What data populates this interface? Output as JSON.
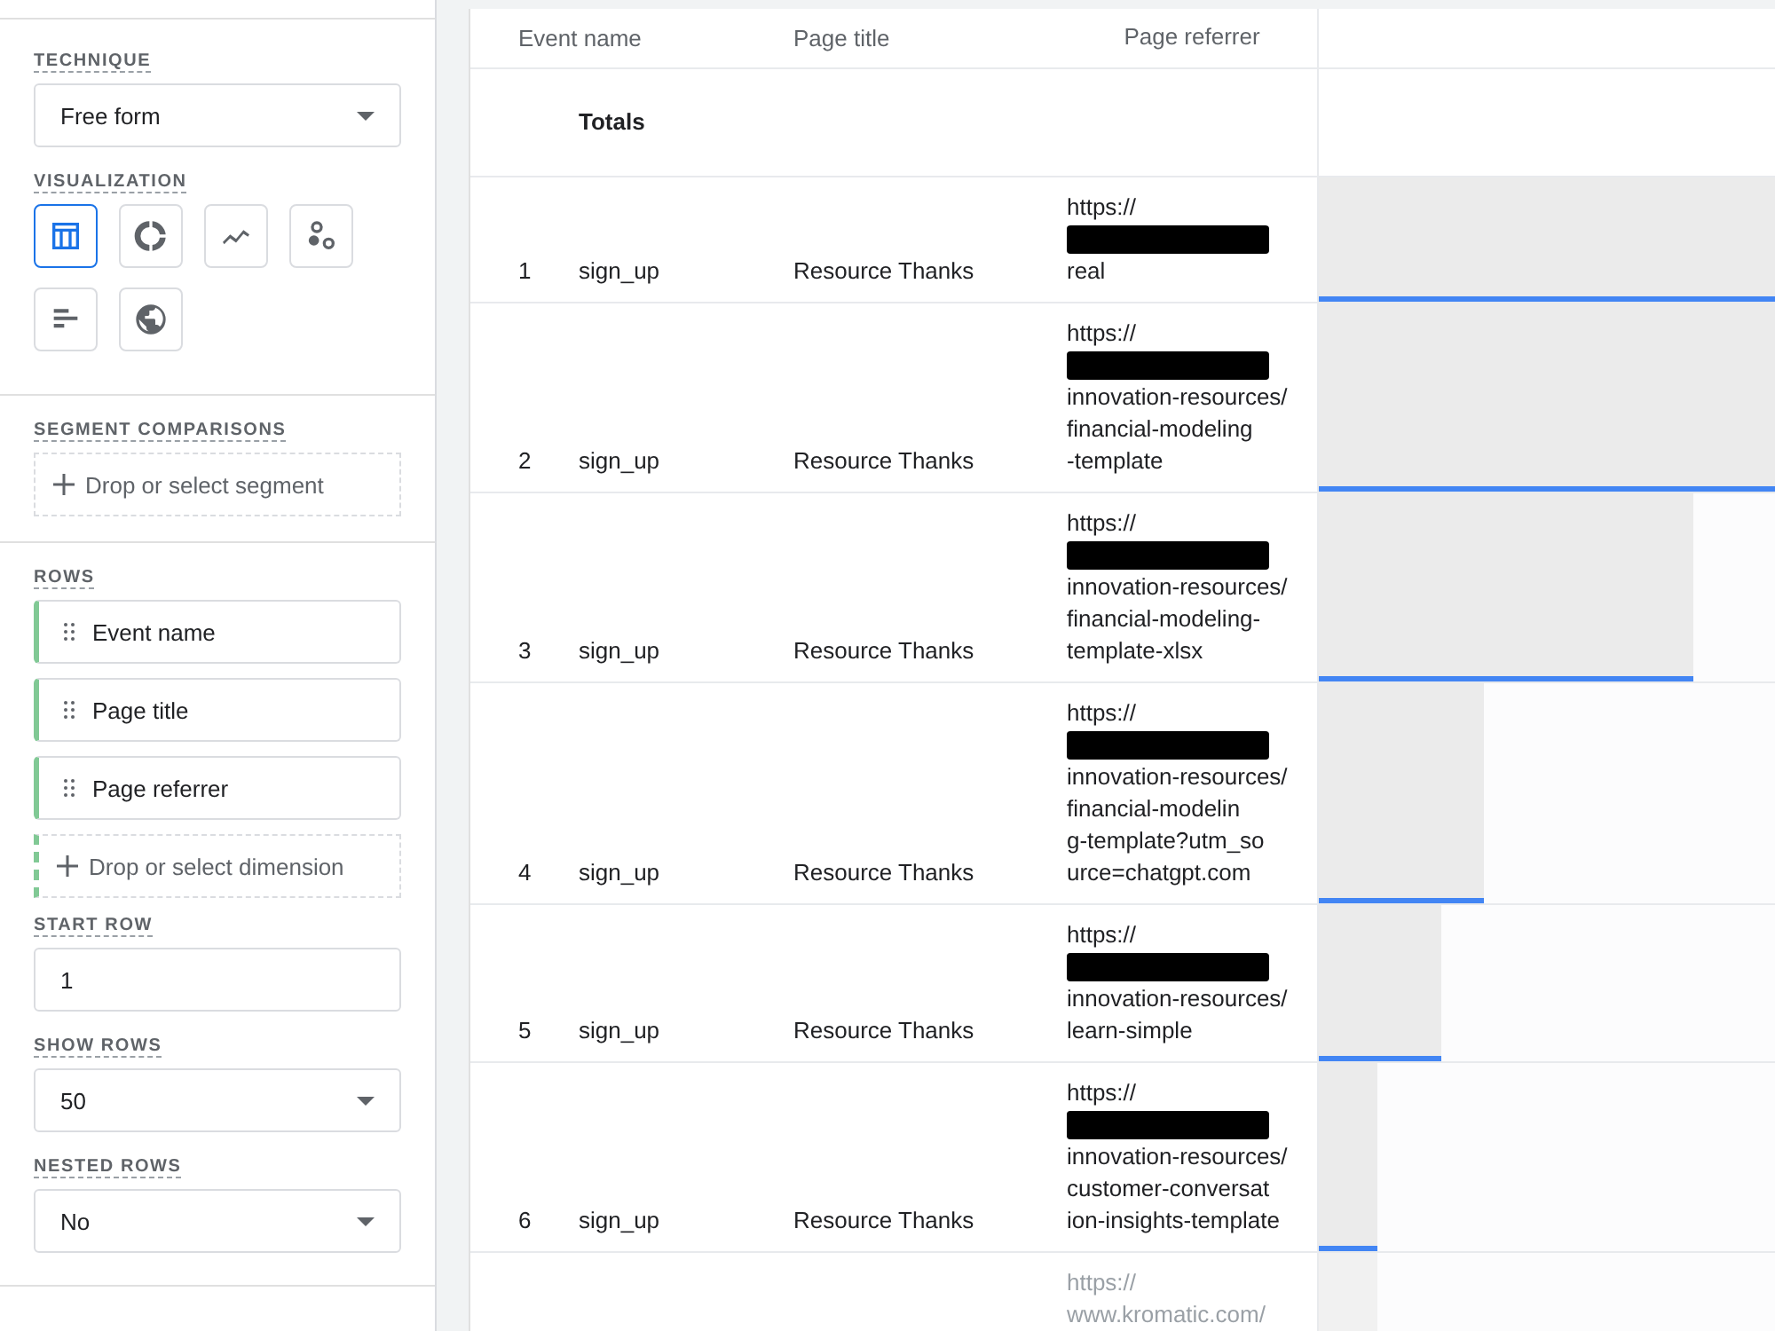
{
  "settings": {
    "technique": {
      "label": "TECHNIQUE",
      "value": "Free form"
    },
    "visualization": {
      "label": "VISUALIZATION",
      "options": [
        {
          "kind": "table",
          "selected": true
        },
        {
          "kind": "donut",
          "selected": false
        },
        {
          "kind": "line",
          "selected": false
        },
        {
          "kind": "scatter",
          "selected": false
        },
        {
          "kind": "bar",
          "selected": false
        },
        {
          "kind": "geo",
          "selected": false
        }
      ]
    },
    "segment_comparisons": {
      "label": "SEGMENT COMPARISONS",
      "drop": "Drop or select segment"
    },
    "rows": {
      "label": "ROWS",
      "items": [
        "Event name",
        "Page title",
        "Page referrer"
      ],
      "drop": "Drop or select dimension"
    },
    "start_row": {
      "label": "START ROW",
      "value": "1"
    },
    "show_rows": {
      "label": "SHOW ROWS",
      "value": "50"
    },
    "nested_rows": {
      "label": "NESTED ROWS",
      "value": "No"
    }
  },
  "table": {
    "columns": [
      "Event name",
      "Page title",
      "Page referrer"
    ],
    "totals_label": "Totals",
    "rows": [
      {
        "index": "1",
        "event": "sign_up",
        "title": "Resource Thanks",
        "referrer": [
          "https://",
          "real"
        ],
        "redacted": true,
        "level": 1.0,
        "faded": false
      },
      {
        "index": "2",
        "event": "sign_up",
        "title": "Resource Thanks",
        "referrer": [
          "https://",
          "innovation-resources/",
          "financial-modeling",
          "-template"
        ],
        "redacted": true,
        "level": 1.0,
        "faded": false
      },
      {
        "index": "3",
        "event": "sign_up",
        "title": "Resource Thanks",
        "referrer": [
          "https://",
          "innovation-resources/",
          "financial-modeling-",
          "template-xlsx"
        ],
        "redacted": true,
        "level": 0.82,
        "faded": false
      },
      {
        "index": "4",
        "event": "sign_up",
        "title": "Resource Thanks",
        "referrer": [
          "https://",
          "innovation-resources/",
          "financial-modelin",
          "g-template?utm_so",
          "urce=chatgpt.com"
        ],
        "redacted": true,
        "level": 0.36,
        "faded": false
      },
      {
        "index": "5",
        "event": "sign_up",
        "title": "Resource Thanks",
        "referrer": [
          "https://",
          "innovation-resources/",
          "learn-simple"
        ],
        "redacted": true,
        "level": 0.27,
        "faded": false
      },
      {
        "index": "6",
        "event": "sign_up",
        "title": "Resource Thanks",
        "referrer": [
          "https://",
          "innovation-resources/",
          "customer-conversat",
          "ion-insights-template"
        ],
        "redacted": true,
        "level": 0.13,
        "faded": false
      },
      {
        "referrer": [
          "https://",
          "www.kromatic.com/"
        ],
        "redacted": false,
        "level": 0.13,
        "faded": true
      }
    ]
  }
}
